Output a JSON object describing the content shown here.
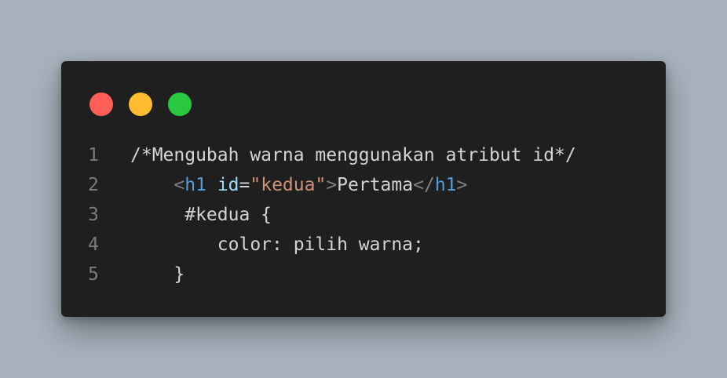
{
  "colors": {
    "background": "#a8b2bd",
    "window": "#1f1f1f",
    "dot_red": "#ff5f57",
    "dot_yellow": "#febc2e",
    "dot_green": "#28c840"
  },
  "window_controls": [
    {
      "name": "close",
      "color": "#ff5f57"
    },
    {
      "name": "minimize",
      "color": "#febc2e"
    },
    {
      "name": "maximize",
      "color": "#28c840"
    }
  ],
  "code_lines": [
    {
      "number": "1",
      "tokens": [
        {
          "t": "/*Mengubah warna menggunakan atribut id*/",
          "k": "plain"
        }
      ]
    },
    {
      "number": "2",
      "tokens": [
        {
          "t": "    ",
          "k": "plain"
        },
        {
          "t": "<",
          "k": "punct"
        },
        {
          "t": "h1",
          "k": "tag"
        },
        {
          "t": " ",
          "k": "plain"
        },
        {
          "t": "id",
          "k": "attr"
        },
        {
          "t": "=",
          "k": "plain"
        },
        {
          "t": "\"kedua\"",
          "k": "str"
        },
        {
          "t": ">",
          "k": "punct"
        },
        {
          "t": "Pertama",
          "k": "plain"
        },
        {
          "t": "</",
          "k": "punct"
        },
        {
          "t": "h1",
          "k": "tag"
        },
        {
          "t": ">",
          "k": "punct"
        }
      ]
    },
    {
      "number": "3",
      "tokens": [
        {
          "t": "     #kedua {",
          "k": "plain"
        }
      ]
    },
    {
      "number": "4",
      "tokens": [
        {
          "t": "        color: pilih warna;",
          "k": "plain"
        }
      ]
    },
    {
      "number": "5",
      "tokens": [
        {
          "t": "    }",
          "k": "plain"
        }
      ]
    }
  ]
}
